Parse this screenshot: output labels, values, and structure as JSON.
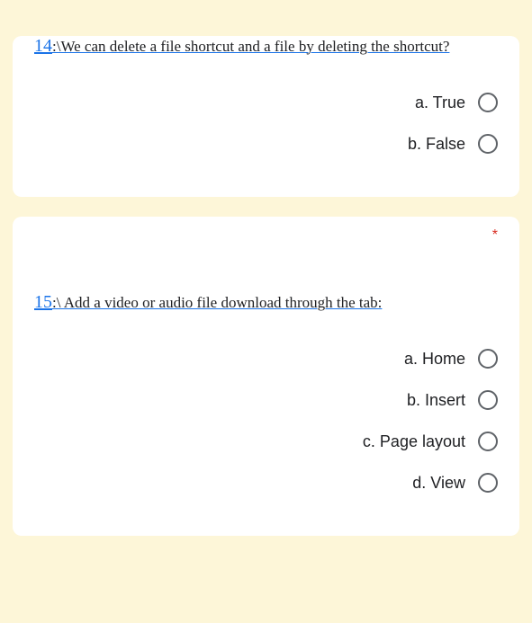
{
  "questions": [
    {
      "number": "14",
      "separator": ":\\",
      "text": "We can delete a file shortcut and a file by deleting the shortcut?",
      "required": true,
      "options": [
        {
          "label": "a. True"
        },
        {
          "label": "b. False"
        }
      ]
    },
    {
      "number": "15",
      "separator": ":\\",
      "text": " Add a video or audio file download through the tab:",
      "required": true,
      "required_mark": "*",
      "options": [
        {
          "label": "a. Home"
        },
        {
          "label": "b. Insert"
        },
        {
          "label": "c. Page layout"
        },
        {
          "label": "d. View"
        }
      ]
    }
  ]
}
